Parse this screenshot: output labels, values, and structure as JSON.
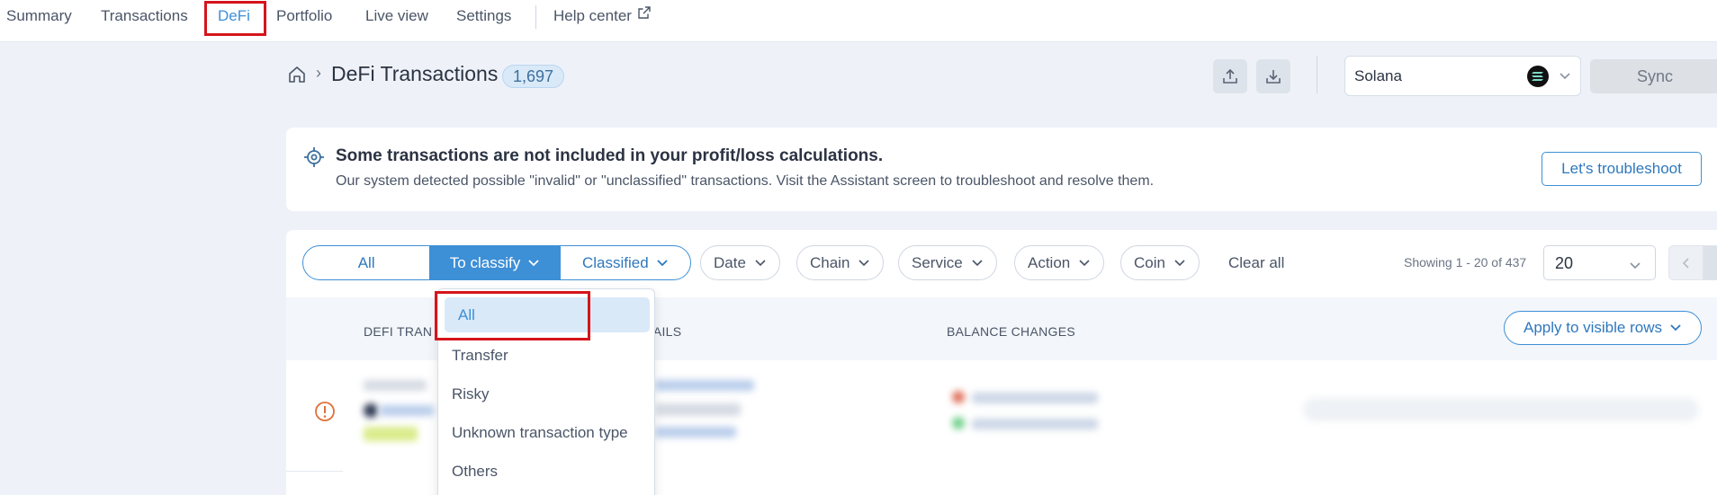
{
  "nav": {
    "items": [
      "Summary",
      "Transactions",
      "DeFi",
      "Portfolio",
      "Live view",
      "Settings"
    ],
    "help": "Help center",
    "active": "DeFi"
  },
  "header": {
    "title": "DeFi Transactions",
    "count": "1,697",
    "chain": "Solana",
    "sync": "Sync"
  },
  "alert": {
    "title": "Some transactions are not included in your profit/loss calculations.",
    "text": "Our system detected possible \"invalid\" or \"unclassified\" transactions. Visit the Assistant screen to troubleshoot and resolve them.",
    "button": "Let's troubleshoot"
  },
  "filters": {
    "segments": [
      "All",
      "To classify",
      "Classified"
    ],
    "pills": [
      "Date",
      "Chain",
      "Service",
      "Action",
      "Coin"
    ],
    "clear": "Clear all",
    "showing": "Showing 1 - 20 of 437",
    "page_size": "20"
  },
  "table": {
    "col1": "DEFI TRAN",
    "col2": "TAILS",
    "col3": "BALANCE CHANGES",
    "apply": "Apply to visible rows"
  },
  "dropdown": {
    "items": [
      "All",
      "Transfer",
      "Risky",
      "Unknown transaction type",
      "Others"
    ],
    "selected": "All"
  },
  "colors": {
    "accent": "#3d8fd6",
    "highlight": "#d5141b",
    "warning": "#e0703a"
  }
}
